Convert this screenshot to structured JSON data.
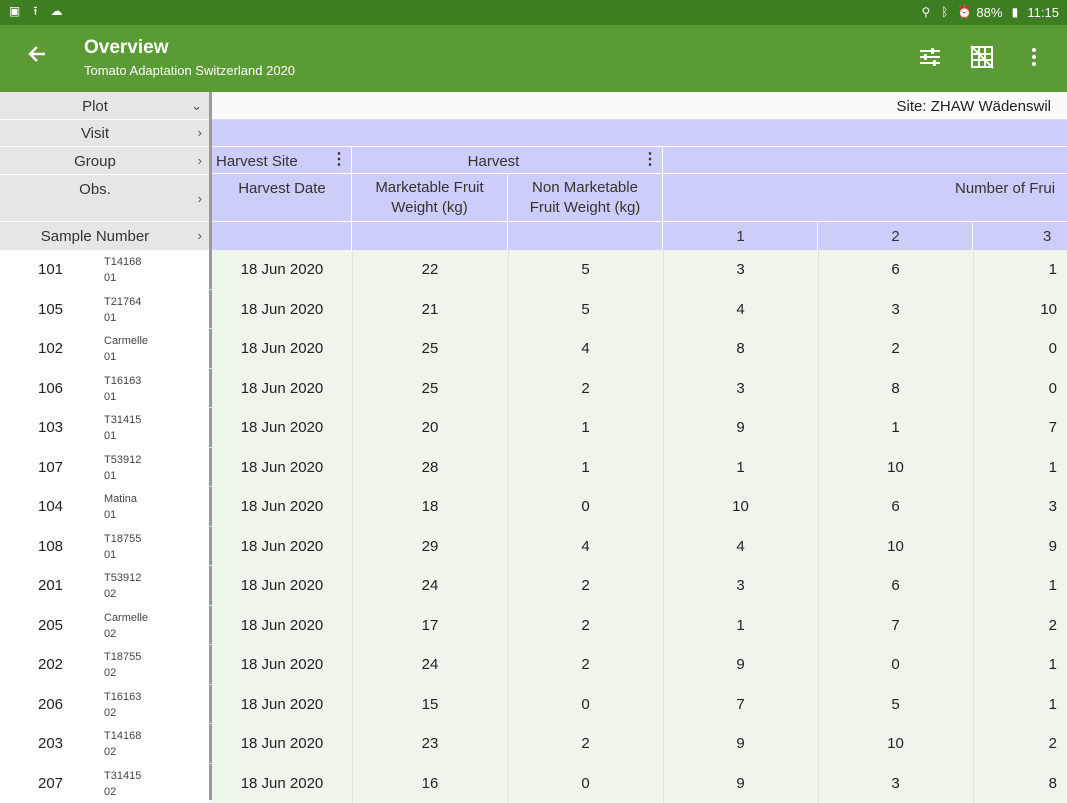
{
  "statusbar": {
    "battery": "88%",
    "time": "11:15"
  },
  "appbar": {
    "title": "Overview",
    "subtitle": "Tomato Adaptation Switzerland 2020"
  },
  "left_header": {
    "plot": "Plot",
    "visit": "Visit",
    "group": "Group",
    "obs": "Obs.",
    "sample_number": "Sample Number"
  },
  "site_label": "Site: ZHAW Wädenswil",
  "groups": {
    "harvest_site": "Harvest Site",
    "harvest": "Harvest"
  },
  "columns": {
    "harvest_date": "Harvest Date",
    "marketable_l1": "Marketable Fruit",
    "marketable_l2": "Weight (kg)",
    "non_marketable_l1": "Non Marketable",
    "non_marketable_l2": "Fruit Weight (kg)",
    "number_of_fruit": "Number of Frui",
    "sub1": "1",
    "sub2": "2",
    "sub3": "3"
  },
  "rows": [
    {
      "num": "101",
      "code1": "T14168",
      "code2": "01",
      "date": "18 Jun 2020",
      "mkt": "22",
      "nonmkt": "5",
      "n1": "3",
      "n2": "6",
      "n3": "1"
    },
    {
      "num": "105",
      "code1": "T21764",
      "code2": "01",
      "date": "18 Jun 2020",
      "mkt": "21",
      "nonmkt": "5",
      "n1": "4",
      "n2": "3",
      "n3": "10"
    },
    {
      "num": "102",
      "code1": "Carmelle",
      "code2": "01",
      "date": "18 Jun 2020",
      "mkt": "25",
      "nonmkt": "4",
      "n1": "8",
      "n2": "2",
      "n3": "0"
    },
    {
      "num": "106",
      "code1": "T16163",
      "code2": "01",
      "date": "18 Jun 2020",
      "mkt": "25",
      "nonmkt": "2",
      "n1": "3",
      "n2": "8",
      "n3": "0"
    },
    {
      "num": "103",
      "code1": "T31415",
      "code2": "01",
      "date": "18 Jun 2020",
      "mkt": "20",
      "nonmkt": "1",
      "n1": "9",
      "n2": "1",
      "n3": "7"
    },
    {
      "num": "107",
      "code1": "T53912",
      "code2": "01",
      "date": "18 Jun 2020",
      "mkt": "28",
      "nonmkt": "1",
      "n1": "1",
      "n2": "10",
      "n3": "1"
    },
    {
      "num": "104",
      "code1": "Matina",
      "code2": "01",
      "date": "18 Jun 2020",
      "mkt": "18",
      "nonmkt": "0",
      "n1": "10",
      "n2": "6",
      "n3": "3"
    },
    {
      "num": "108",
      "code1": "T18755",
      "code2": "01",
      "date": "18 Jun 2020",
      "mkt": "29",
      "nonmkt": "4",
      "n1": "4",
      "n2": "10",
      "n3": "9"
    },
    {
      "num": "201",
      "code1": "T53912",
      "code2": "02",
      "date": "18 Jun 2020",
      "mkt": "24",
      "nonmkt": "2",
      "n1": "3",
      "n2": "6",
      "n3": "1"
    },
    {
      "num": "205",
      "code1": "Carmelle",
      "code2": "02",
      "date": "18 Jun 2020",
      "mkt": "17",
      "nonmkt": "2",
      "n1": "1",
      "n2": "7",
      "n3": "2"
    },
    {
      "num": "202",
      "code1": "T18755",
      "code2": "02",
      "date": "18 Jun 2020",
      "mkt": "24",
      "nonmkt": "2",
      "n1": "9",
      "n2": "0",
      "n3": "1"
    },
    {
      "num": "206",
      "code1": "T16163",
      "code2": "02",
      "date": "18 Jun 2020",
      "mkt": "15",
      "nonmkt": "0",
      "n1": "7",
      "n2": "5",
      "n3": "1"
    },
    {
      "num": "203",
      "code1": "T14168",
      "code2": "02",
      "date": "18 Jun 2020",
      "mkt": "23",
      "nonmkt": "2",
      "n1": "9",
      "n2": "10",
      "n3": "2"
    },
    {
      "num": "207",
      "code1": "T31415",
      "code2": "02",
      "date": "18 Jun 2020",
      "mkt": "16",
      "nonmkt": "0",
      "n1": "9",
      "n2": "3",
      "n3": "8"
    }
  ]
}
